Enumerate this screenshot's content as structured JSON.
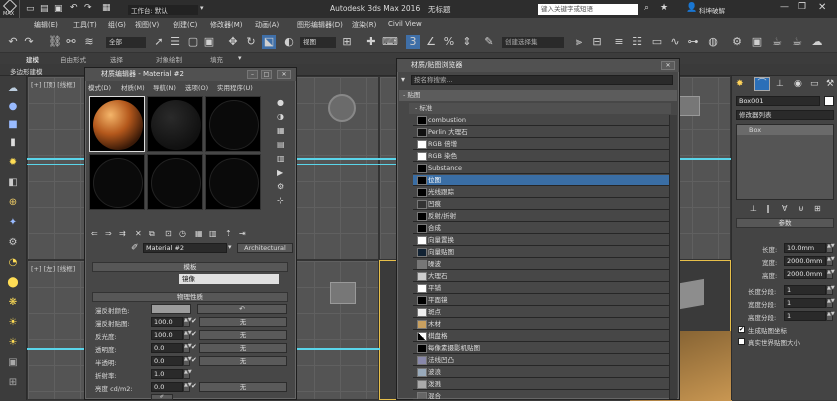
{
  "app": {
    "title_left": "工作台: 默认",
    "title_center": "Autodesk 3ds Max 2016",
    "title_doc": "无标题",
    "search_placeholder": "键入关键字或短语",
    "user": "科坤破解",
    "max_button": "MAX"
  },
  "menus": [
    "编辑(E)",
    "工具(T)",
    "组(G)",
    "视图(V)",
    "创建(C)",
    "修改器(M)",
    "动画(A)",
    "图形编辑器(D)",
    "渲染(R)",
    "Civil View"
  ],
  "toolbar": {
    "view_dropdown": "全部",
    "coord_dropdown": "视图",
    "selection_set": "创建选择集"
  },
  "ribbon_tabs": [
    "建模",
    "自由形式",
    "选择",
    "对象绘制",
    "填充"
  ],
  "ribbon_sub": "多边形建模",
  "viewports": {
    "top": "[+] [顶] [线框]",
    "left": "[+] [左] [线框]"
  },
  "mat_editor": {
    "title": "材质编辑器 - Material #2",
    "menu": [
      "模式(D)",
      "材质(M)",
      "导航(N)",
      "选项(O)",
      "实用程序(U)"
    ],
    "material_name": "Material #2",
    "material_type": "Architectural",
    "rollout_template": "模板",
    "template_value": "镜像",
    "rollout_phys": "物理性质",
    "props": [
      {
        "label": "漫反射颜色:",
        "value": "",
        "map": ""
      },
      {
        "label": "漫反射贴图:",
        "value": "100.0",
        "map": "无"
      },
      {
        "label": "反光度:",
        "value": "100.0",
        "map": "无"
      },
      {
        "label": "透明度:",
        "value": "0.0",
        "map": "无"
      },
      {
        "label": "半透明:",
        "value": "0.0",
        "map": "无"
      },
      {
        "label": "折射率:",
        "value": "1.0",
        "map": ""
      },
      {
        "label": "亮度 cd/m2:",
        "value": "0.0",
        "map": "无"
      }
    ]
  },
  "map_browser": {
    "title": "材质/贴图浏览器",
    "search_placeholder": "按名称搜索...",
    "group_maps": "- 贴图",
    "group_standard": "- 标准",
    "items": [
      "combustion",
      "Perlin 大理石",
      "RGB 倍增",
      "RGB 染色",
      "Substance",
      "位图",
      "光线跟踪",
      "凹痕",
      "反射/折射",
      "合成",
      "向量置换",
      "向量贴图",
      "噪波",
      "大理石",
      "平铺",
      "平面镜",
      "斑点",
      "木材",
      "棋盘格",
      "每像素摄影机贴图",
      "法线凹凸",
      "波浪",
      "泼溅",
      "混合",
      "渐变"
    ],
    "selected": "位图"
  },
  "right_panel": {
    "object_name": "Box001",
    "modifier_list": "修改器列表",
    "stack_item": "Box",
    "rollout_params": "参数",
    "params": [
      {
        "label": "长度:",
        "value": "10.0mm"
      },
      {
        "label": "宽度:",
        "value": "2000.0mm"
      },
      {
        "label": "高度:",
        "value": "2000.0mm"
      },
      {
        "label": "长度分段:",
        "value": "1"
      },
      {
        "label": "宽度分段:",
        "value": "1"
      },
      {
        "label": "高度分段:",
        "value": "1"
      }
    ],
    "check_uv": "生成贴图坐标",
    "check_real": "真实世界贴图大小"
  }
}
